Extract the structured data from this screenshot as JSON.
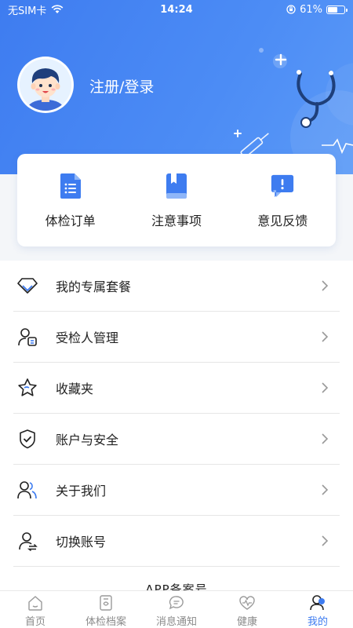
{
  "status_bar": {
    "carrier": "无SIM卡",
    "time": "14:24",
    "battery": "61%",
    "battery_level": 0.61
  },
  "profile": {
    "login_text": "注册/登录"
  },
  "quick_actions": [
    {
      "label": "体检订单",
      "icon": "document-list-icon"
    },
    {
      "label": "注意事项",
      "icon": "book-icon"
    },
    {
      "label": "意见反馈",
      "icon": "feedback-alert-icon"
    }
  ],
  "menu": [
    {
      "label": "我的专属套餐",
      "icon": "diamond-icon"
    },
    {
      "label": "受检人管理",
      "icon": "person-card-icon"
    },
    {
      "label": "收藏夹",
      "icon": "star-icon"
    },
    {
      "label": "账户与安全",
      "icon": "shield-check-icon"
    },
    {
      "label": "关于我们",
      "icon": "people-icon"
    },
    {
      "label": "切换账号",
      "icon": "switch-user-icon"
    }
  ],
  "footer_partial_text": "APP备案号",
  "tabbar": [
    {
      "label": "首页",
      "icon": "home-icon",
      "active": false
    },
    {
      "label": "体检档案",
      "icon": "record-icon",
      "active": false
    },
    {
      "label": "消息通知",
      "icon": "message-icon",
      "active": false
    },
    {
      "label": "健康",
      "icon": "heart-pulse-icon",
      "active": false
    },
    {
      "label": "我的",
      "icon": "user-icon",
      "active": true
    }
  ],
  "colors": {
    "primary": "#3e7cf0",
    "header_gradient_end": "#5b9af7",
    "tab_inactive": "#8a8a8a"
  }
}
